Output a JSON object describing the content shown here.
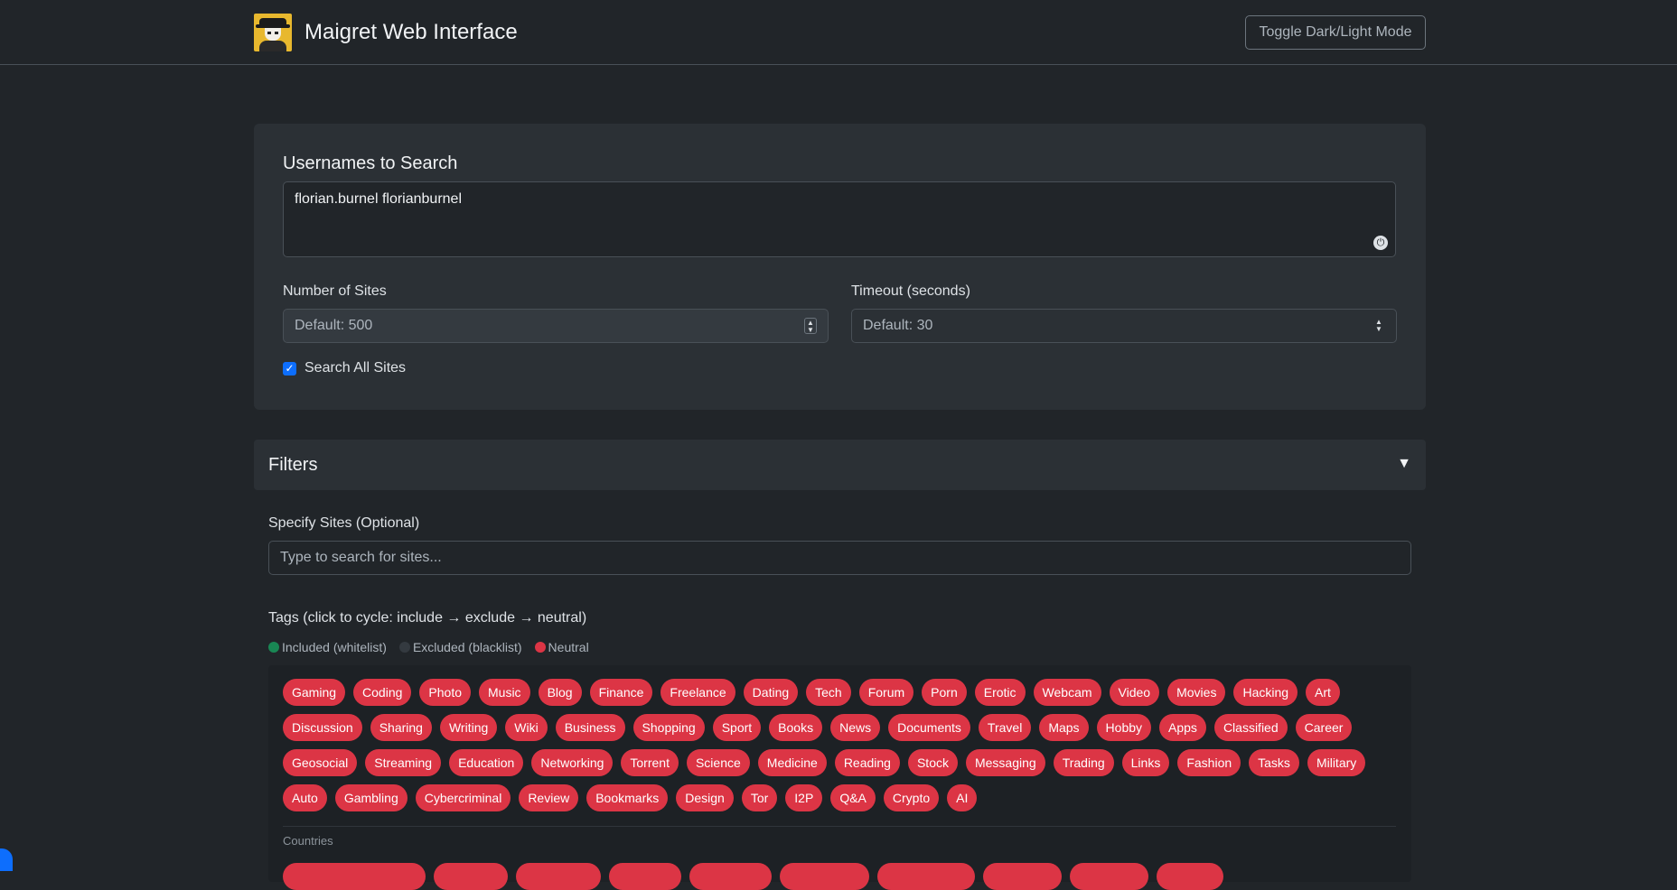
{
  "nav": {
    "title": "Maigret Web Interface",
    "toggle_label": "Toggle Dark/Light Mode"
  },
  "search": {
    "usernames_label": "Usernames to Search",
    "usernames_value": "florian.burnel florianburnel",
    "sites_label": "Number of Sites",
    "sites_placeholder": "Default: 500",
    "timeout_label": "Timeout (seconds)",
    "timeout_placeholder": "Default: 30",
    "all_sites_label": "Search All Sites",
    "all_sites_checked": true
  },
  "filters": {
    "title": "Filters",
    "arrow": "▼",
    "specify_label": "Specify Sites (Optional)",
    "specify_placeholder": "Type to search for sites...",
    "tags_label": "Tags (click to cycle: include → exclude → neutral)",
    "legend": [
      {
        "label": "Included (whitelist)",
        "color": "#198754"
      },
      {
        "label": "Excluded (blacklist)",
        "color": "#343a40"
      },
      {
        "label": "Neutral",
        "color": "#dc3545"
      }
    ],
    "tag_rows": [
      [
        "Gaming",
        "Coding",
        "Photo",
        "Music",
        "Blog",
        "Finance",
        "Freelance",
        "Dating",
        "Tech",
        "Forum",
        "Porn",
        "Erotic",
        "Webcam",
        "Video",
        "Movies",
        "Hacking",
        "Art"
      ],
      [
        "Discussion",
        "Sharing",
        "Writing",
        "Wiki",
        "Business",
        "Shopping",
        "Sport",
        "Books",
        "News",
        "Documents",
        "Travel",
        "Maps",
        "Hobby",
        "Apps",
        "Classified",
        "Career"
      ],
      [
        "Geosocial",
        "Streaming",
        "Education",
        "Networking",
        "Torrent",
        "Science",
        "Medicine",
        "Reading",
        "Stock",
        "Messaging",
        "Trading",
        "Links",
        "Fashion",
        "Tasks",
        "Military"
      ],
      [
        "Auto",
        "Gambling",
        "Cybercriminal",
        "Review",
        "Bookmarks",
        "Design",
        "Tor",
        "I2P",
        "Q&A",
        "Crypto",
        "AI"
      ]
    ],
    "countries_label": "Countries",
    "tag_color_neutral": "#dc3545"
  }
}
